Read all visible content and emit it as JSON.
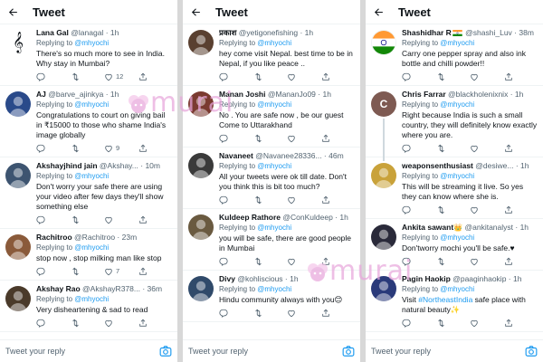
{
  "header_title": "Tweet",
  "composer": {
    "placeholder": "Tweet your reply"
  },
  "watermark": {
    "text": "murai",
    "color": "#e8a7dc"
  },
  "colors": {
    "link": "#1d9bf0",
    "muted": "#536471",
    "text": "#0f1419",
    "divider": "#eff3f4"
  },
  "panels": [
    {
      "tweets": [
        {
          "name": "Lana Gal",
          "handle": "@lanagal",
          "time": "1h",
          "replying_label": "Replying to",
          "mention": "@mhyochi",
          "text": "There's so much more to see in India. Why stay in Mumbai?",
          "replies": "",
          "retweets": "",
          "likes": "12",
          "avatar": {
            "icon": "treble-clef-icon",
            "bg": "#ffffff",
            "fg": "#0f1419",
            "glyph": "𝄞"
          }
        },
        {
          "name": "AJ",
          "handle": "@barve_ajinkya",
          "time": "1h",
          "replying_label": "Replying to",
          "mention": "@mhyochi",
          "text": "Congratulations to court on giving bail in ₹15000 to those who shame India's image globally",
          "replies": "",
          "retweets": "",
          "likes": "9",
          "avatar": {
            "icon": "user-avatar",
            "bg": "#2a4a8a",
            "fg": "#ffffff",
            "glyph": ""
          }
        },
        {
          "name": "Akshayjhind jain",
          "handle": "@Akshay...",
          "time": "10m",
          "replying_label": "Replying to",
          "mention": "@mhyochi",
          "text": "Don't worry your safe there are using your video after few days they'll show something else",
          "replies": "",
          "retweets": "",
          "likes": "",
          "avatar": {
            "icon": "user-avatar",
            "bg": "#3d5470",
            "fg": "#ffffff",
            "glyph": ""
          }
        },
        {
          "name": "Rachitroo",
          "handle": "@Rachitroo",
          "time": "23m",
          "replying_label": "Replying to",
          "mention": "@mhyochi",
          "text": "stop now , stop milking man like stop",
          "replies": "",
          "retweets": "",
          "likes": "7",
          "avatar": {
            "icon": "user-avatar",
            "bg": "#8a5a3a",
            "fg": "#ffffff",
            "glyph": ""
          }
        },
        {
          "name": "Akshay Rao",
          "handle": "@AkshayR378...",
          "time": "36m",
          "replying_label": "Replying to",
          "mention": "@mhyochi",
          "text": "Very disheartening & sad to read",
          "replies": "",
          "retweets": "",
          "likes": "",
          "avatar": {
            "icon": "user-avatar",
            "bg": "#4a3a2a",
            "fg": "#ffffff",
            "glyph": ""
          }
        }
      ]
    },
    {
      "tweets": [
        {
          "name": "प्रकाश",
          "handle": "@yetigonefishing",
          "time": "1h",
          "replying_label": "Replying to",
          "mention": "@mhyochi",
          "text": "hey come visit Nepal. best time to be in Nepal, if you like peace ..",
          "replies": "",
          "retweets": "",
          "likes": "",
          "avatar": {
            "icon": "user-avatar",
            "bg": "#5a4030",
            "fg": "#ffffff",
            "glyph": ""
          }
        },
        {
          "name": "Manan Joshi",
          "handle": "@MananJo09",
          "time": "1h",
          "replying_label": "Replying to",
          "mention": "@mhyochi",
          "text": "No . You are safe now , be our guest Come to Uttarakhand",
          "replies": "",
          "retweets": "",
          "likes": "",
          "avatar": {
            "icon": "user-avatar",
            "bg": "#7a3a30",
            "fg": "#ffffff",
            "glyph": ""
          }
        },
        {
          "name": "Navaneet",
          "handle": "@Navanee28336...",
          "time": "46m",
          "replying_label": "Replying to",
          "mention": "@mhyochi",
          "text": "All your tweets were ok till date. Don't you think this is bit too much?",
          "replies": "",
          "retweets": "",
          "likes": "",
          "avatar": {
            "icon": "user-avatar",
            "bg": "#3a3a3a",
            "fg": "#ffffff",
            "glyph": ""
          }
        },
        {
          "name": "Kuldeep Rathore",
          "handle": "@ConKuldeep",
          "time": "1h",
          "replying_label": "Replying to",
          "mention": "@mhyochi",
          "text": "you will be safe, there are good people in Mumbai",
          "replies": "",
          "retweets": "",
          "likes": "",
          "avatar": {
            "icon": "user-avatar",
            "bg": "#6a5a40",
            "fg": "#ffffff",
            "glyph": ""
          }
        },
        {
          "name": "Divy",
          "handle": "@kohliscious",
          "time": "1h",
          "replying_label": "Replying to",
          "mention": "@mhyochi",
          "text": "Hindu community always with you😊",
          "replies": "",
          "retweets": "",
          "likes": "",
          "avatar": {
            "icon": "user-avatar",
            "bg": "#304a6a",
            "fg": "#ffffff",
            "glyph": ""
          }
        }
      ]
    },
    {
      "tweets": [
        {
          "name": "Shashidhar R",
          "handle": "@shashi_Luv",
          "time": "38m",
          "replying_label": "Replying to",
          "mention": "@mhyochi",
          "text": "Carry one pepper spray and also ink bottle and chilli powder!!",
          "replies": "",
          "retweets": "",
          "likes": "",
          "flag": "india-flag-icon",
          "avatar": {
            "icon": "india-flag-avatar",
            "bg": "#ffffff",
            "fg": "#ffffff",
            "glyph": ""
          }
        },
        {
          "name": "Chris Farrar",
          "handle": "@blackholenixnix",
          "time": "1h",
          "replying_label": "Replying to",
          "mention": "@mhyochi",
          "text": "Right because India is such a small country, they will definitely know exactly where you are.",
          "replies": "",
          "retweets": "",
          "likes": "",
          "avatar": {
            "icon": "letter-avatar",
            "bg": "#7e5a52",
            "fg": "#ffffff",
            "glyph": "C"
          }
        },
        {
          "name": "weaponsenthusiast",
          "handle": "@desiwe...",
          "time": "1h",
          "replying_label": "Replying to",
          "mention": "@mhyochi",
          "text": "This will be streaming it live. So yes they can know where she is.",
          "replies": "",
          "retweets": "",
          "likes": "",
          "avatar": {
            "icon": "user-avatar",
            "bg": "#c9a23a",
            "fg": "#ffffff",
            "glyph": ""
          }
        },
        {
          "name": "Ankita sawant",
          "handle": "@ankitanalyst",
          "time": "1h",
          "replying_label": "Replying to",
          "mention": "@mhyochi",
          "text": "Don'tworry mochi you'll be safe.♥",
          "replies": "",
          "retweets": "",
          "likes": "",
          "badge": "👑",
          "avatar": {
            "icon": "user-avatar",
            "bg": "#2a2a3a",
            "fg": "#ffffff",
            "glyph": ""
          }
        },
        {
          "name": "Pagin Haokip",
          "handle": "@paaginhaokip",
          "time": "1h",
          "replying_label": "Replying to",
          "mention": "@mhyochi",
          "text_parts": [
            "Visit ",
            "#NortheastIndia",
            "  safe place with natural beauty✨"
          ],
          "replies": "",
          "retweets": "",
          "likes": "",
          "avatar": {
            "icon": "user-avatar",
            "bg": "#2a3a7a",
            "fg": "#ffffff",
            "glyph": ""
          }
        }
      ]
    }
  ]
}
